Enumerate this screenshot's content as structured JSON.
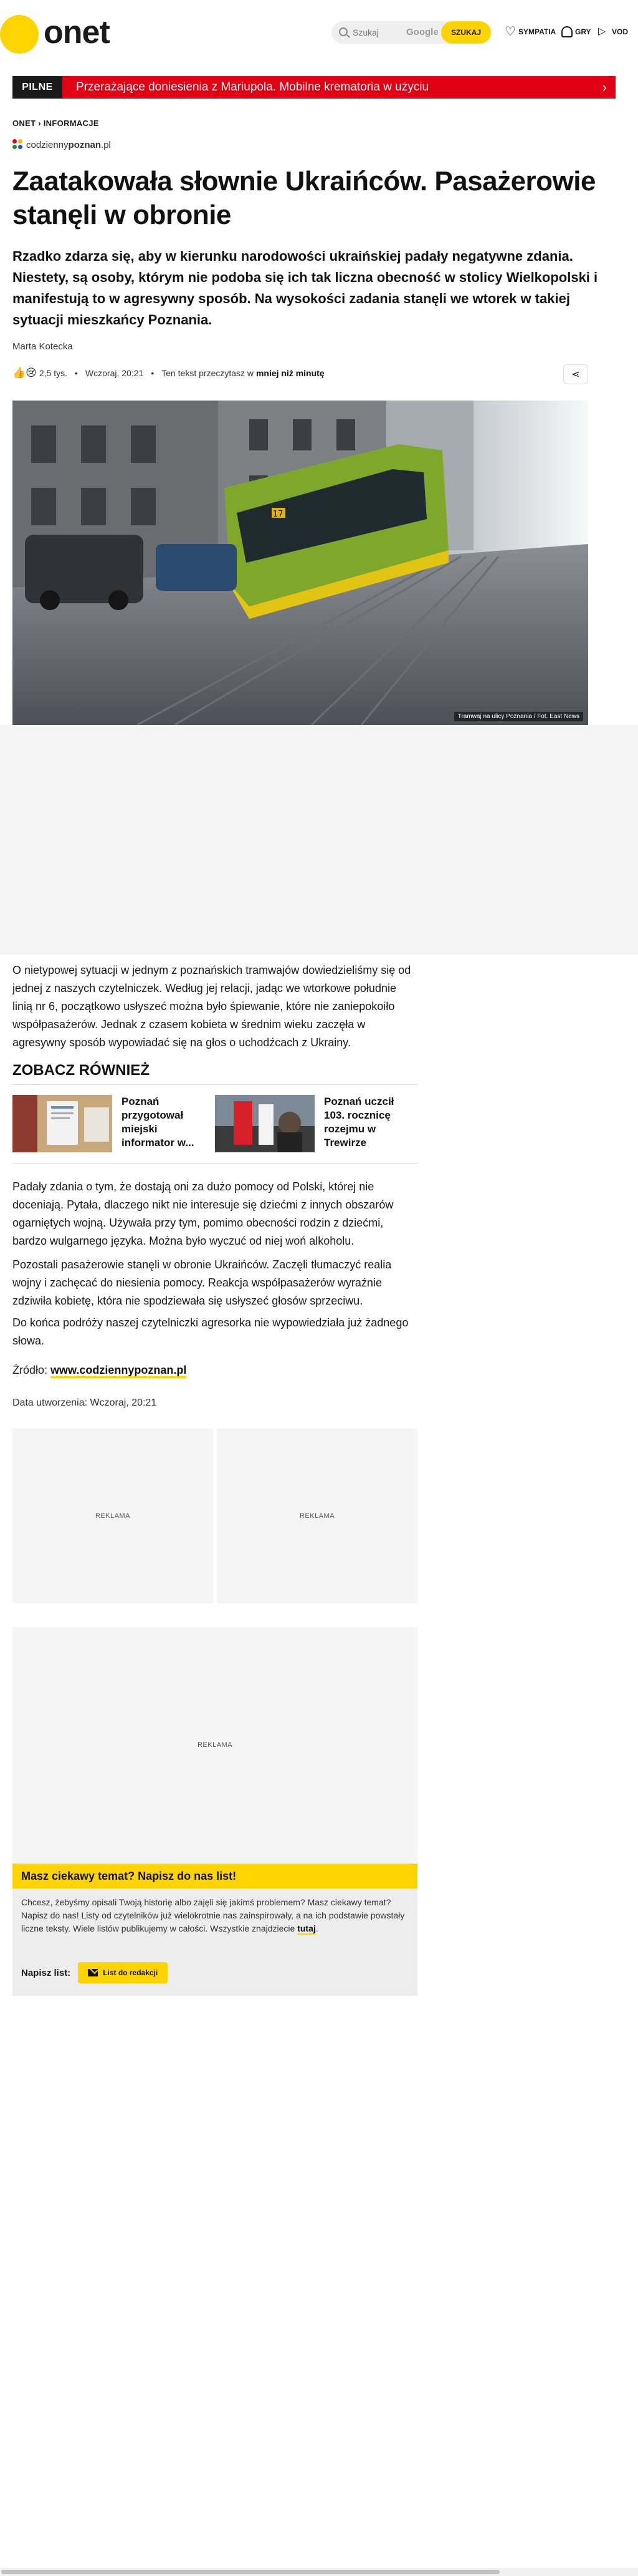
{
  "header": {
    "logo_text": "onet",
    "search_placeholder": "Szukaj",
    "google_label": "Google",
    "search_button": "SZUKAJ",
    "links": [
      "SYMPATIA",
      "GRY",
      "VOD"
    ]
  },
  "pilne": {
    "label": "PILNE",
    "text": "Przerażające doniesienia z Mariupola. Mobilne krematoria w użyciu"
  },
  "article": {
    "breadcrumb": "ONET › INFORMACJE",
    "source_name_light": "codzienny",
    "source_name_bold": "poznan",
    "source_name_tld": ".pl",
    "title": "Zaatakowała słownie Ukraińców. Pasażerowie stanęli w obronie",
    "lead": "Rzadko zdarza się, aby w kierunku narodowości ukraińskiej padały negatywne zdania. Niestety, są osoby, którym nie podoba się ich tak liczna obecność w stolicy Wielkopolski i manifestują to w agresywny sposób. Na wysokości zadania stanęli we wtorek w takiej sytuacji mieszkańcy Poznania.",
    "author": "Marta Kotecka",
    "reactions": "2,5 tys.",
    "date": "Wczoraj, 20:21",
    "read_time_prefix": "Ten tekst przeczytasz w",
    "read_time_value": "mniej niż minutę",
    "photo_credit": "Tramwaj na ulicy Poznania / Fot. East News",
    "p1": "O nietypowej sytuacji w jednym z poznańskich tramwajów dowiedzieliśmy się od jednej z naszych czytelniczek. Według jej relacji, jadąc we wtorkowe południe linią nr 6, początkowo usłyszeć można było śpiewanie, które nie zaniepokoiło współpasażerów. Jednak z czasem kobieta w średnim wieku zaczęła w agresywny sposób wypowiadać się na głos o uchodźcach z Ukrainy.",
    "p2": "Padały zdania o tym, że dostają oni za dużo pomocy od Polski, której nie doceniają. Pytała, dlaczego nikt nie interesuje się dziećmi z innych obszarów ogarniętych wojną. Używała przy tym, pomimo obecności rodzin z dziećmi, bardzo wulgarnego języka. Można było wyczuć od niej woń alkoholu.",
    "p3": "Pozostali pasażerowie stanęli w obronie Ukraińców. Zaczęli tłumaczyć realia wojny i zachęcać do niesienia pomocy. Reakcja współpasażerów wyraźnie zdziwiła kobietę, która nie spodziewała się usłyszeć głosów sprzeciwu.",
    "p4": "Do końca podróży naszej czytelniczki agresorka nie wypowiedziała już żadnego słowa.",
    "source_label": "Źródło:",
    "source_link": "www.codziennypoznan.pl",
    "created_label": "Data utworzenia: Wczoraj, 20:21"
  },
  "see_also": {
    "title": "ZOBACZ RÓWNIEŻ",
    "items": [
      {
        "label": "Poznań przygotował miejski informator w..."
      },
      {
        "label": "Poznań uczcił 103. rocznicę rozejmu w Trewirze"
      }
    ]
  },
  "ads": {
    "label": "REKLAMA"
  },
  "letter": {
    "title": "Masz ciekawy temat? Napisz do nas list!",
    "body": "Chcesz, żebyśmy opisali Twoją historię albo zajęli się jakimś problemem? Masz ciekawy temat? Napisz do nas! Listy od czytelników już wielokrotnie nas zainspirowały, a na ich podstawie powstały liczne teksty. Wiele listów publikujemy w całości. Wszystkie znajdziecie",
    "link": "tutaj",
    "cta_label": "Napisz list:",
    "button": "List do redakcji"
  },
  "colors": {
    "brand_yellow": "#ffd400",
    "pilne_red": "#e10014"
  }
}
